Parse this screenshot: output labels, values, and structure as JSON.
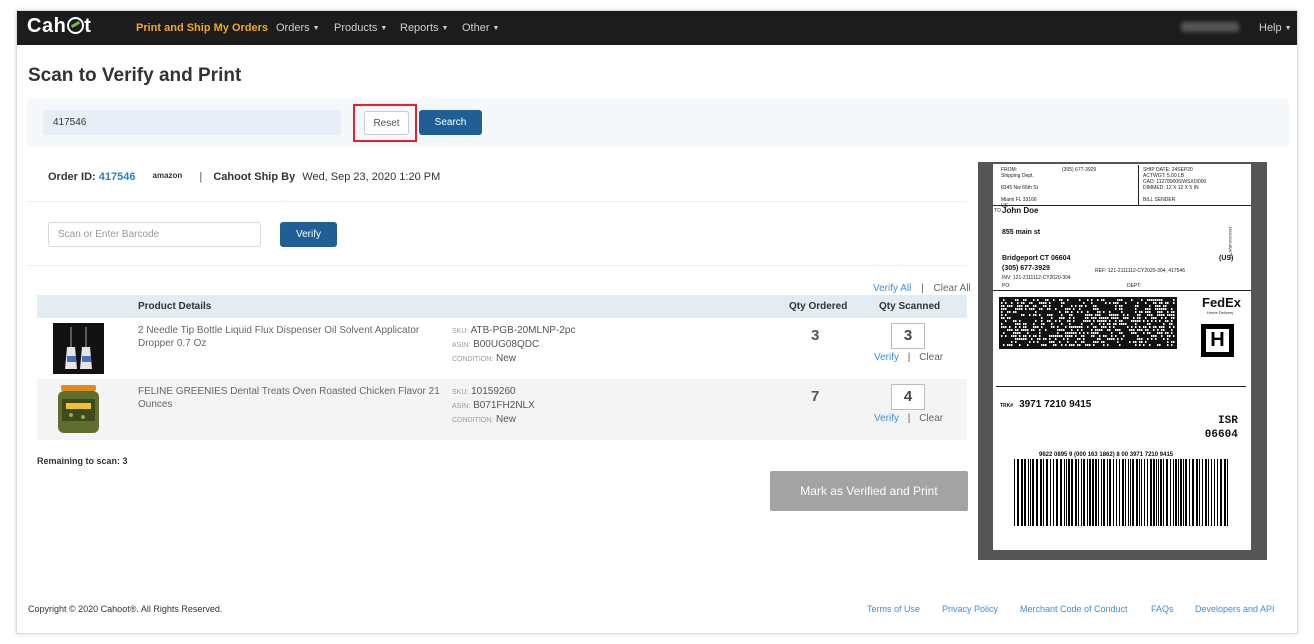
{
  "navbar": {
    "logo": "Cahoot",
    "items": [
      {
        "label": "Print and Ship My Orders",
        "active": true
      },
      {
        "label": "Orders"
      },
      {
        "label": "Products"
      },
      {
        "label": "Reports"
      },
      {
        "label": "Other"
      }
    ],
    "help": "Help"
  },
  "page": {
    "title": "Scan to Verify and Print"
  },
  "search": {
    "value": "417546",
    "reset_label": "Reset",
    "search_label": "Search"
  },
  "order": {
    "id_label": "Order ID:",
    "id": "417546",
    "channel": "amazon",
    "ship_by_label": "Cahoot Ship By",
    "ship_by": "Wed, Sep 23, 2020 1:20 PM"
  },
  "verify": {
    "placeholder": "Scan or Enter Barcode",
    "button": "Verify",
    "verify_all": "Verify All",
    "clear_all": "Clear All"
  },
  "table": {
    "headers": {
      "product": "Product Details",
      "qty_ordered": "Qty Ordered",
      "qty_scanned": "Qty Scanned"
    },
    "rows": [
      {
        "title": "2 Needle Tip Bottle Liquid Flux Dispenser Oil Solvent Applicator Dropper 0.7 Oz",
        "sku": "ATB-PGB-20MLNP-2pc",
        "asin": "B00UG08QDC",
        "condition": "New",
        "qty_ordered": "3",
        "qty_scanned": "3",
        "verify": "Verify",
        "clear": "Clear"
      },
      {
        "title": "FELINE GREENIES Dental Treats Oven Roasted Chicken Flavor 21 Ounces",
        "sku": "10159260",
        "asin": "B071FH2NLX",
        "condition": "New",
        "qty_ordered": "7",
        "qty_scanned": "4",
        "verify": "Verify",
        "clear": "Clear"
      }
    ],
    "field_labels": {
      "sku": "SKU:",
      "asin": "ASIN:",
      "condition": "CONDITION:"
    }
  },
  "remaining": "Remaining to scan: 3",
  "mark_button": "Mark as Verified and Print",
  "label": {
    "from_block": "FROM:\nShipping Dept.\n\n8345 Nw 66th St\n\nMiami FL 33166\nUS",
    "from_phone": "(305) 677-3929",
    "ship_info": "SHIP DATE: 24SEP20\nACTWGT: 5.00 LB\nCAD: 112789006/WSXI3000\nDIMMED: 12 X 12 X 5 IN\n\nBILL SENDER",
    "to_label": "TO",
    "to_name": "John Doe",
    "to_street": "855 main st",
    "to_city": "Bridgeport CT 06604",
    "to_country": "(US)",
    "to_phone": "(305) 677-3929",
    "ref": "REF: 121-2111112-CY2020-304, 417546",
    "inv": "INV: 121-2111112-CY2020-304",
    "po": "PO:",
    "dept": "DEPT:",
    "side_code": "J36G2/1E4B/8766",
    "carrier": "FedEx",
    "service": "Home Delivery",
    "h_mark": "H",
    "trk_label": "TRK#",
    "tracking": "3971 7210 9415",
    "isr": "ISR",
    "zip": "06604",
    "barcode_caption": "9622 0895 9 (000 163 1862) 8 00 3971 7210 9415"
  },
  "footer": {
    "copyright": "Copyright © 2020 Cahoot®. All Rights Reserved.",
    "links": [
      "Terms of Use",
      "Privacy Policy",
      "Merchant Code of Conduct",
      "FAQs",
      "Developers and API"
    ]
  },
  "colors": {
    "navbar": "#1c1c1c",
    "active_nav": "#f5a623",
    "primary_button": "#1f5f96",
    "link": "#3d8fd4",
    "highlight": "#e8202a"
  }
}
